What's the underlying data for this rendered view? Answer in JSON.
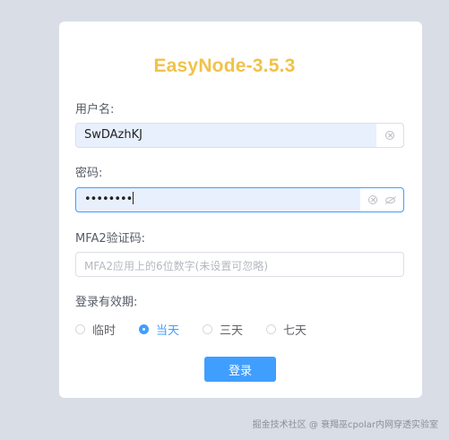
{
  "app_title": "EasyNode-3.5.3",
  "username": {
    "label": "用户名:",
    "value": "SwDAzhKJ"
  },
  "password": {
    "label": "密码:",
    "value": "••••••••"
  },
  "mfa": {
    "label": "MFA2验证码:",
    "placeholder": "MFA2应用上的6位数字(未设置可忽略)"
  },
  "validity": {
    "label": "登录有效期:",
    "options": [
      "临时",
      "当天",
      "三天",
      "七天"
    ],
    "selected": "当天"
  },
  "login_button": "登录",
  "watermark": "掘金技术社区 @ 衰羯巫cpolar内网穿透实验室",
  "colors": {
    "accent": "#409eff",
    "title": "#f0c24a",
    "background": "#d9dde6"
  },
  "icons": {
    "clear": "circle-close-icon",
    "password_toggle": "eye-slash-icon"
  }
}
